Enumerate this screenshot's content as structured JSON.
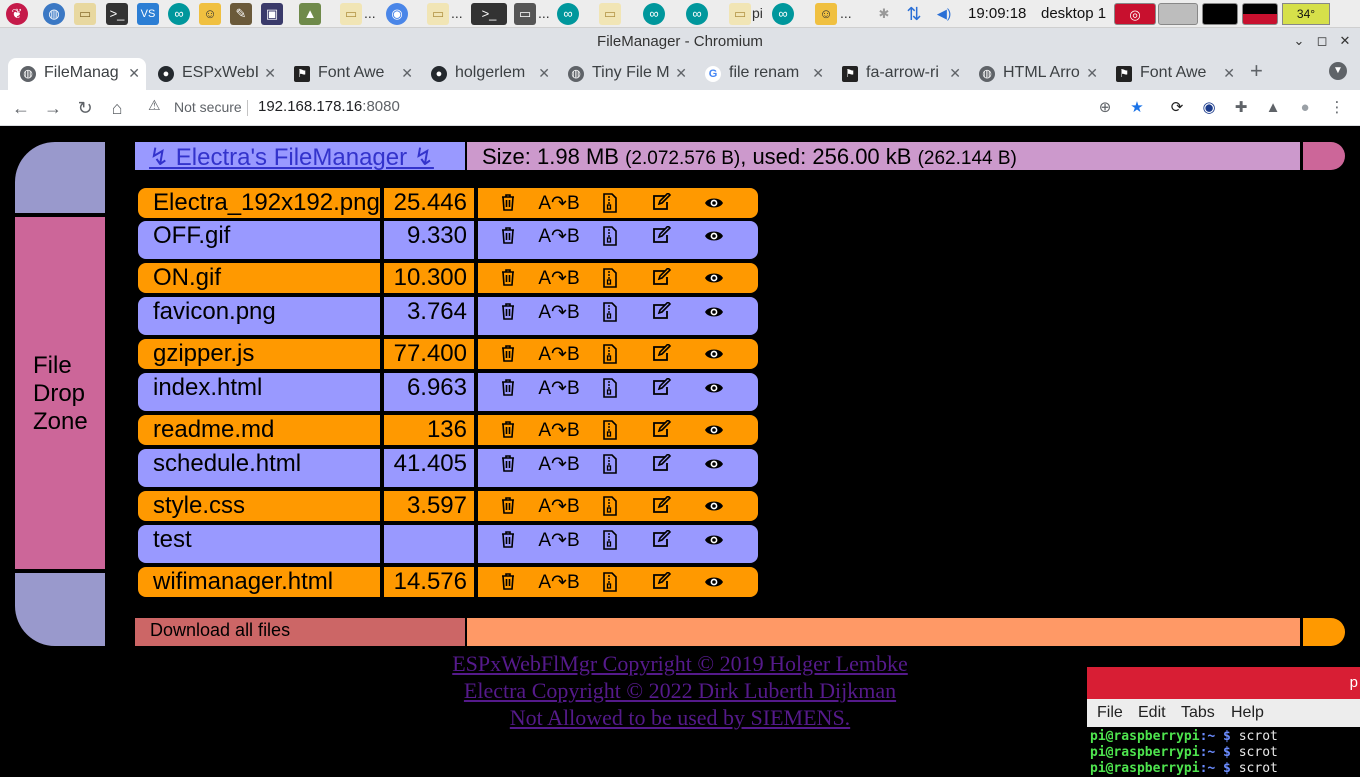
{
  "taskbar": {
    "clock": "19:09:18",
    "desktop_label": "desktop 1",
    "temperature": "34°",
    "folder_labels": [
      "...",
      "...",
      "...",
      "pi",
      "..."
    ]
  },
  "window": {
    "title": "FileManager - Chromium"
  },
  "tabs": [
    {
      "label": "FileManag",
      "favicon": "globe-icon",
      "active": true
    },
    {
      "label": "ESPxWebI",
      "favicon": "github-icon",
      "active": false
    },
    {
      "label": "Font Awe",
      "favicon": "fontawesome-icon",
      "active": false
    },
    {
      "label": "holgerlem",
      "favicon": "github-icon",
      "active": false
    },
    {
      "label": "Tiny File M",
      "favicon": "globe-icon",
      "active": false
    },
    {
      "label": "file renam",
      "favicon": "google-icon",
      "active": false
    },
    {
      "label": "fa-arrow-ri",
      "favicon": "fontawesome-icon",
      "active": false
    },
    {
      "label": "HTML Arro",
      "favicon": "globe-icon",
      "active": false
    },
    {
      "label": "Font Awe",
      "favicon": "fontawesome-icon",
      "active": false
    }
  ],
  "toolbar": {
    "not_secure": "Not secure",
    "url_host": "192.168.178.16",
    "url_port": ":8080"
  },
  "page": {
    "title": "↯ Electra's FileManager ↯",
    "size_text": "Size: 1.98 MB",
    "size_bytes": "(2.072.576 B)",
    "used_text": ", used: 256.00 kB",
    "used_bytes": "(262.144 B)",
    "dropzone_lines": [
      "File",
      "Drop",
      "Zone"
    ],
    "download_all": "Download all files",
    "rename_label": "A↷B"
  },
  "files": [
    {
      "name": "Electra_192x192.png",
      "size": "25.446"
    },
    {
      "name": "OFF.gif",
      "size": "9.330"
    },
    {
      "name": "ON.gif",
      "size": "10.300"
    },
    {
      "name": "favicon.png",
      "size": "3.764"
    },
    {
      "name": "gzipper.js",
      "size": "77.400"
    },
    {
      "name": "index.html",
      "size": "6.963"
    },
    {
      "name": "readme.md",
      "size": "136"
    },
    {
      "name": "schedule.html",
      "size": "41.405"
    },
    {
      "name": "style.css",
      "size": "3.597"
    },
    {
      "name": "test",
      "size": ""
    },
    {
      "name": "wifimanager.html",
      "size": "14.576"
    }
  ],
  "credits": [
    "ESPxWebFlMgr Copyright © 2019 Holger Lembke",
    "Electra Copyright © 2022 Dirk Luberth Dijkman",
    "Not Allowed to be used by SIEMENS."
  ],
  "terminal": {
    "title_letter": "p",
    "menu": [
      "File",
      "Edit",
      "Tabs",
      "Help"
    ],
    "lines": [
      {
        "user": "pi@raspberrypi",
        "path": ":~ $",
        "cmd": " scrot"
      },
      {
        "user": "pi@raspberrypi",
        "path": ":~ $",
        "cmd": " scrot"
      },
      {
        "user": "pi@raspberrypi",
        "path": ":~ $",
        "cmd": " scrot"
      }
    ]
  },
  "colors": {
    "lcars_lilac": "#9999ff",
    "lcars_orange": "#ff9900",
    "lcars_pink": "#cc6699",
    "lcars_mauve": "#cc99cc",
    "terminal_title": "#d81e34"
  }
}
